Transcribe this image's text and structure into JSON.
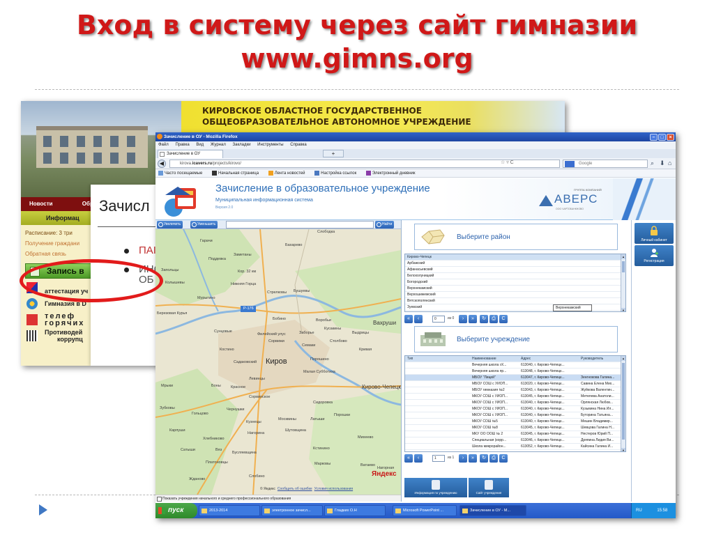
{
  "slide": {
    "title_line1": "Вход в систему через сайт гимназии",
    "title_line2": "www.gimns.org"
  },
  "gymnasium_site": {
    "banner_line1": "КИРОВСКОЕ ОБЛАСТНОЕ ГОСУДАРСТВЕННОЕ",
    "banner_line2": "ОБЩЕОБРАЗОВАТЕЛЬНОЕ АВТОНОМНОЕ УЧРЕЖДЕНИЕ",
    "nav": [
      "Новости",
      "Обр"
    ],
    "info_bar": "Информац",
    "links": [
      "Расписание: 3 три",
      "Получение граждани",
      "Обратная связь"
    ],
    "zapis_button": "Запись в",
    "attestation": "аттестация уч",
    "gymnasium_in": "Гимназия в D",
    "phone_line1": "телеф",
    "phone_line2": "горячих",
    "anticorruption_line1": "Противодей",
    "anticorruption_line2": "коррупц",
    "panel_title": "Зачисл",
    "bullet_1": "ПАІ",
    "bullet_2a": "ИНС",
    "bullet_2b": "ОБ"
  },
  "firefox": {
    "window_title": "Зачисление в ОУ - Mozilla Firefox",
    "menu": [
      "Файл",
      "Правка",
      "Вид",
      "Журнал",
      "Закладки",
      "Инструменты",
      "Справка"
    ],
    "tab_label": "Зачисление в ОУ",
    "url_prefix": "kirova.",
    "url_host": "icavers.ru",
    "url_path": "/projects/kirovo/",
    "search_placeholder": "Google",
    "bookmarks": [
      "Часто посещаемые",
      "Начальная страница",
      "Лента новостей",
      "Настройка ссылок",
      "Электронный дневник"
    ]
  },
  "app": {
    "title": "Зачисление в образовательное учреждение",
    "subtitle": "Муниципальная информационная система",
    "version": "Версия 2.0",
    "brand_group": "ГРУППА КОМПАНИЙ",
    "brand_name": "АВЕРС",
    "brand_ltd": "ООО ЧАРТОБАНКНОВО"
  },
  "map": {
    "zoom_in": "Увеличить",
    "zoom_out": "Уменьшить",
    "find": "Найти",
    "city": "Киров",
    "labels": [
      "Слободка",
      "Гарачи",
      "Бахарево",
      "Заметаны",
      "Поддевка",
      "Запольцы",
      "Кор. 32 км",
      "Колышевы",
      "Нижняя Горца",
      "Стрелковы",
      "Бушуевы",
      "Мурыгино",
      "Р-176",
      "Березовая Курья",
      "Бобино",
      "Воробьи",
      "Вахруши",
      "Сунцовые",
      "Филейский улус",
      "Заборье",
      "Кусакины",
      "Выдрицы",
      "Сорвижи",
      "Столбово",
      "Семаки",
      "Кривая",
      "Костино",
      "Садаковский",
      "Порошино",
      "Малая Субботиха",
      "Мрыки",
      "Боны",
      "Красное",
      "Левинцы",
      "Кирово-Чепецк",
      "Сорвинское",
      "Зубковы",
      "Сидоровка",
      "Гольцово",
      "Чернушки",
      "Кузнецы",
      "Москвины",
      "Латыши",
      "Порошки",
      "Карпуши",
      "Нагорина",
      "Шутовщина",
      "Хлебниково",
      "Михеево",
      "Сатыши",
      "Вяз",
      "Бусляевщина",
      "Кстинино",
      "Платоновцы",
      "Марковы",
      "Ватаево",
      "Жданово",
      "Слобино",
      "Нагорная"
    ],
    "yandex": "Яндекс",
    "copyright": "© Яндекс",
    "link_error": "Сообщить об ошибке",
    "link_terms": "Условия использования",
    "checkbox_label": "Показать учреждения начального и среднего профессионального образования"
  },
  "district": {
    "heading": "Выберите район",
    "list_header": "Кирово-Чепецк",
    "items": [
      "Арбажский",
      "Афанасьевский",
      "Белохолуницкий",
      "Богородский",
      "Верхнекамский",
      "Верхошижемский",
      "Вятскополянский",
      "Зуевский"
    ],
    "popup": "Верхнекамский",
    "page": "0",
    "of": "из 0"
  },
  "institution": {
    "heading": "Выберите учреждение",
    "columns": [
      "Тип",
      "Наименование",
      "Адрес",
      "Руководитель"
    ],
    "rows": [
      [
        "",
        "Вечерняя школа г.К...",
        "613040, г. Кирово-Чепецк...",
        ""
      ],
      [
        "",
        "Вечерняя школа пр...",
        "613048, г. Кирово-Чепецк...",
        ""
      ],
      [
        "",
        "МБОУ \"Лицей\"",
        "613047, г. Кирово-Чепецк...",
        "Зенгнокова Галина..."
      ],
      [
        "",
        "МБОУ СОШ с УИОП...",
        "613020, г. Кирово-Чепецк...",
        "Савина Елена Мих..."
      ],
      [
        "",
        "МБОУ гимназия №2",
        "613043, г. Кирово-Чепецк...",
        "Жуйкова Валентин..."
      ],
      [
        "",
        "МКОУ СОШ с УИОП...",
        "613045, г. Кирово-Чепецк...",
        "Метелева Анатоли..."
      ],
      [
        "",
        "МКОУ СОШ с УИОП...",
        "613040, г. Кирово-Чепецк...",
        "Орлянская Любов..."
      ],
      [
        "",
        "МКОУ СОШ с УИОП...",
        "613040, г. Кирово-Чепецк...",
        "Кузьмина Нина Ил..."
      ],
      [
        "",
        "МКОУ СОШ с УИОП...",
        "613040, г. Кирово-Чепецк...",
        "Буторина Татьяна..."
      ],
      [
        "",
        "МКОУ СОШ №5",
        "613040, г. Кирово-Чепецк...",
        "Мешин Владимир..."
      ],
      [
        "",
        "МКОУ СОШ №8",
        "613045, г. Кирово-Чепецк...",
        "Шевцова Галина Н..."
      ],
      [
        "",
        "МКУ ОО ООШ № 2",
        "613045, г. Кирово-Чепецк...",
        "Нестеров Юрий П..."
      ],
      [
        "",
        "Специальная (корр...",
        "613046, г. Кирово-Чепецк...",
        "Дряпина Лидия Ви..."
      ],
      [
        "",
        "Школа микрорайон...",
        "613052, г. Кирово-Чепецк...",
        "Кайсина Галина И..."
      ]
    ],
    "page": "1",
    "of": "из 1",
    "btn_info": "Информация по учреждению",
    "btn_site": "Сайт учреждения"
  },
  "sidebar": {
    "personal": "Личный кабинет",
    "register": "Регистрация"
  },
  "taskbar": {
    "start": "пуск",
    "tasks": [
      "2013-2014",
      "электронное зачисл...",
      "Гладких О.Н",
      "Microsoft PowerPoint ...",
      "Зачисление в ОУ - М..."
    ],
    "lang": "RU",
    "time": "15:58"
  },
  "colors": {
    "title_red": "#d01818",
    "app_blue": "#2e6fb8",
    "highlight_red": "#e21b1b"
  }
}
